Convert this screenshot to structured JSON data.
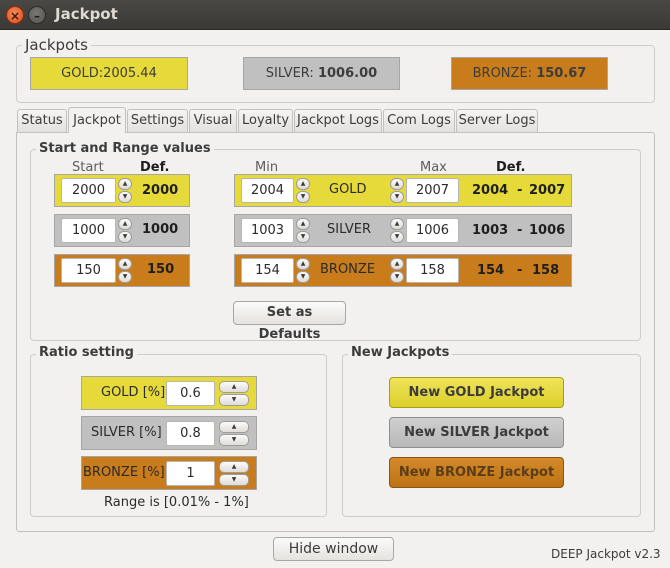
{
  "window": {
    "title": "Jackpot",
    "close_glyph": "×",
    "minimize_glyph": "–"
  },
  "colors": {
    "gold": "#e6da3a",
    "silver": "#c0c0c0",
    "bronze": "#c97c1b"
  },
  "jackpots": {
    "label": "Jackpots",
    "gold": {
      "name": "GOLD:",
      "value": "2005.44"
    },
    "silver": {
      "name": "SILVER:",
      "value": "1006.00"
    },
    "bronze": {
      "name": "BRONZE:",
      "value": "150.67"
    }
  },
  "tabs": [
    "Status",
    "Jackpot",
    "Settings",
    "Visual",
    "Loyalty",
    "Jackpot Logs",
    "Com Logs",
    "Server Logs"
  ],
  "active_tab": "Jackpot",
  "start_range": {
    "label": "Start and Range values",
    "headers": {
      "start": "Start",
      "def": "Def.",
      "min": "Min",
      "max": "Max",
      "def2": "Def."
    },
    "rows": [
      {
        "level": "GOLD",
        "start": "2000",
        "start_def": "2000",
        "min": "2004",
        "max": "2007",
        "range_def_min": "2004",
        "range_sep": "-",
        "range_def_max": "2007"
      },
      {
        "level": "SILVER",
        "start": "1000",
        "start_def": "1000",
        "min": "1003",
        "max": "1006",
        "range_def_min": "1003",
        "range_sep": "-",
        "range_def_max": "1006"
      },
      {
        "level": "BRONZE",
        "start": "150",
        "start_def": "150",
        "min": "154",
        "max": "158",
        "range_def_min": "154",
        "range_sep": "-",
        "range_def_max": "158"
      }
    ],
    "set_defaults_label": "Set as Defaults"
  },
  "ratio": {
    "label": "Ratio setting",
    "rows": [
      {
        "label": "GOLD [%]",
        "value": "0.6"
      },
      {
        "label": "SILVER [%]",
        "value": "0.8"
      },
      {
        "label": "BRONZE [%]",
        "value": "1"
      }
    ],
    "range_text": "Range is [0.01% - 1%]"
  },
  "new_jackpots": {
    "label": "New Jackpots",
    "gold": "New GOLD Jackpot",
    "silver": "New SILVER Jackpot",
    "bronze": "New BRONZE Jackpot"
  },
  "footer": {
    "hide_label": "Hide window",
    "version": "DEEP Jackpot v2.3"
  },
  "icons": {
    "spin_up": "▲",
    "spin_down": "▼"
  }
}
